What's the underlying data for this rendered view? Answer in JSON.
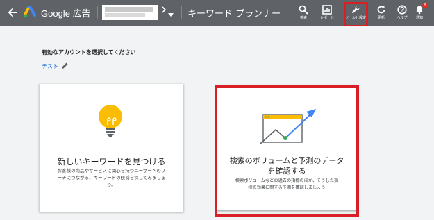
{
  "app": {
    "brand": "Google 広告",
    "page_title": "キーワード プランナー"
  },
  "toolbar": {
    "items": [
      {
        "icon": "search-icon",
        "label": "検索"
      },
      {
        "icon": "report-icon",
        "label": "レポート"
      },
      {
        "icon": "wrench-icon",
        "label": "ツールと設定"
      },
      {
        "icon": "refresh-icon",
        "label": "更新"
      },
      {
        "icon": "help-icon",
        "label": "ヘルプ"
      },
      {
        "icon": "bell-icon",
        "label": "通知",
        "badge": "!"
      }
    ]
  },
  "main": {
    "heading": "有効なアカウントを選択してください",
    "account_link": "テスト"
  },
  "cards": [
    {
      "title": "新しいキーワードを見つける",
      "desc_lines": [
        "お客様の商品やサービスに関心を持つユーザーへのリ",
        "ーチにつながる、キーワードの候補を探してみましょ",
        "う。"
      ]
    },
    {
      "title_lines": [
        "検索のボリュームと予測のデータ",
        "を確認する"
      ],
      "desc_lines": [
        "検索ボリュームなどの過去の指標のほか、そうした指",
        "標の効果に関する予測を確認しましょう"
      ]
    }
  ],
  "colors": {
    "topbar": "#5f6368",
    "background": "#f1f3f4",
    "link": "#1a73e8",
    "highlight": "#d91f26",
    "bulb": "#fbbc04",
    "chart_accent": "#4285f4"
  }
}
